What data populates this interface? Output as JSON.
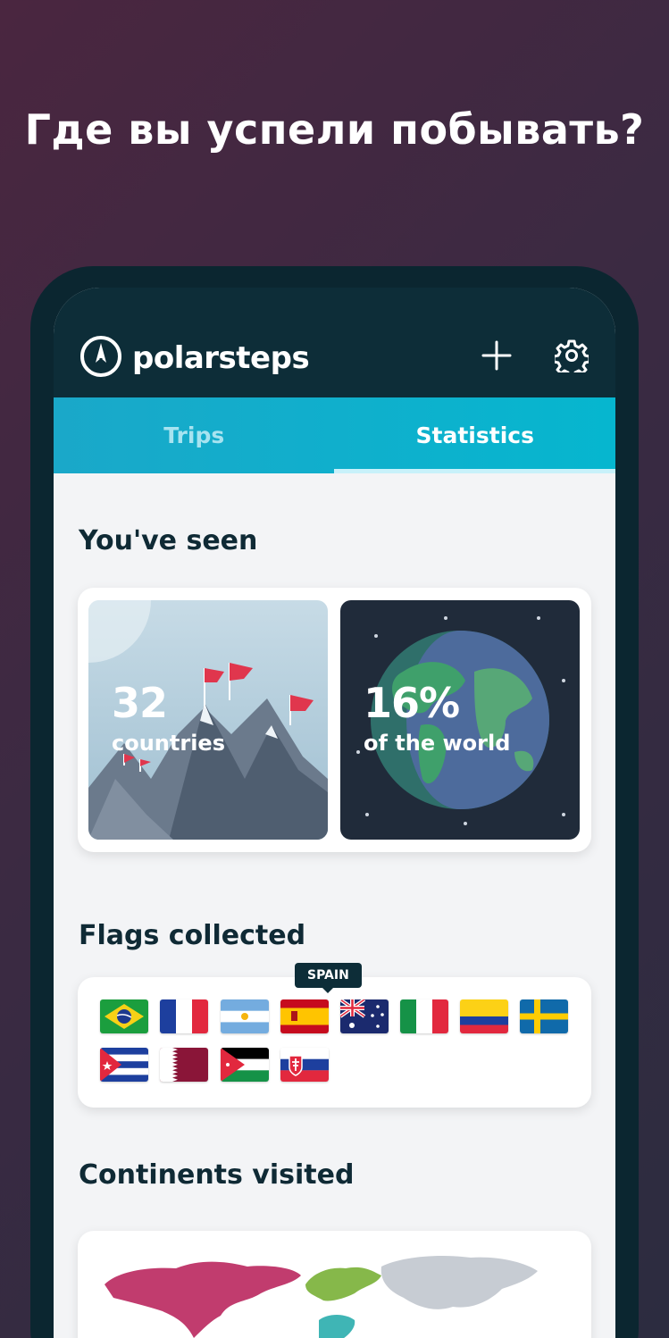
{
  "headline": "Где вы успели побывать?",
  "app": {
    "logo_text": "polarsteps",
    "add_icon": "plus-icon",
    "settings_icon": "gear-icon"
  },
  "tabs": [
    {
      "label": "Trips",
      "active": false
    },
    {
      "label": "Statistics",
      "active": true
    }
  ],
  "seen": {
    "title": "You've seen",
    "countries_value": "32",
    "countries_label": "countries",
    "world_value": "16%",
    "world_label": "of the world"
  },
  "flags": {
    "title": "Flags collected",
    "tooltip": "SPAIN",
    "items": [
      "brazil",
      "france",
      "argentina",
      "spain",
      "australia",
      "italy",
      "colombia",
      "sweden",
      "cuba",
      "qatar",
      "jordan",
      "slovakia"
    ]
  },
  "continents": {
    "title": "Continents visited"
  },
  "colors": {
    "appbar": "#0d2d38",
    "tab_accent": "#06b6cf",
    "heading": "#0f2a35"
  }
}
